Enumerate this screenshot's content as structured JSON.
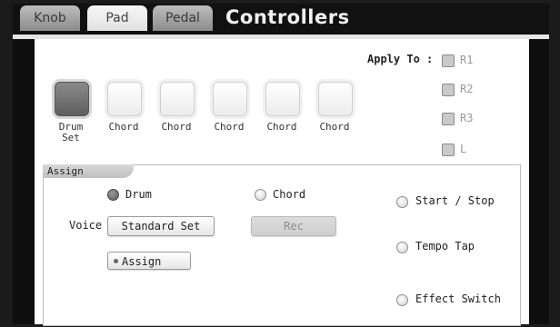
{
  "header": {
    "tabs": [
      {
        "label": "Knob",
        "active": false
      },
      {
        "label": "Pad",
        "active": true
      },
      {
        "label": "Pedal",
        "active": false
      }
    ],
    "title": "Controllers"
  },
  "apply_to": {
    "label": "Apply To :",
    "options": [
      {
        "label": "R1",
        "checked": false
      },
      {
        "label": "R2",
        "checked": false
      },
      {
        "label": "R3",
        "checked": false
      },
      {
        "label": "L",
        "checked": false
      }
    ]
  },
  "pads": [
    {
      "label_line1": "Drum",
      "label_line2": "Set",
      "selected": true
    },
    {
      "label_line1": "Chord",
      "label_line2": "",
      "selected": false
    },
    {
      "label_line1": "Chord",
      "label_line2": "",
      "selected": false
    },
    {
      "label_line1": "Chord",
      "label_line2": "",
      "selected": false
    },
    {
      "label_line1": "Chord",
      "label_line2": "",
      "selected": false
    },
    {
      "label_line1": "Chord",
      "label_line2": "",
      "selected": false
    }
  ],
  "assign": {
    "title": "Assign",
    "drum_label": "Drum",
    "chord_label": "Chord",
    "voice_label": "Voice",
    "voice_value": "Standard Set",
    "rec_label": "Rec",
    "assign_button": "Assign",
    "start_stop_label": "Start / Stop",
    "tempo_tap_label": "Tempo Tap",
    "effect_switch_label": "Effect Switch"
  },
  "colors": {
    "background": "#1b1b1b",
    "panel": "#ffffff",
    "selected_pad": "#6e6e6e",
    "disabled_text": "#8e8e8e"
  }
}
